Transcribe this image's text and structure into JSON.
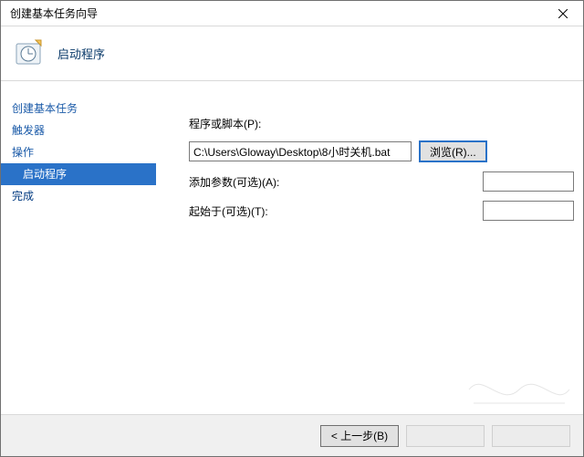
{
  "window": {
    "title": "创建基本任务向导"
  },
  "header": {
    "title": "启动程序"
  },
  "sidebar": {
    "items": [
      {
        "label": "创建基本任务",
        "sub": false,
        "active": false
      },
      {
        "label": "触发器",
        "sub": false,
        "active": false
      },
      {
        "label": "操作",
        "sub": false,
        "active": false
      },
      {
        "label": "启动程序",
        "sub": true,
        "active": true
      },
      {
        "label": "完成",
        "sub": false,
        "active": false
      }
    ]
  },
  "form": {
    "script_label": "程序或脚本(P):",
    "script_value": "C:\\Users\\Gloway\\Desktop\\8小时关机.bat",
    "browse_label": "浏览(R)...",
    "args_label": "添加参数(可选)(A):",
    "args_value": "",
    "startin_label": "起始于(可选)(T):",
    "startin_value": ""
  },
  "footer": {
    "back": "< 上一步(B)"
  }
}
